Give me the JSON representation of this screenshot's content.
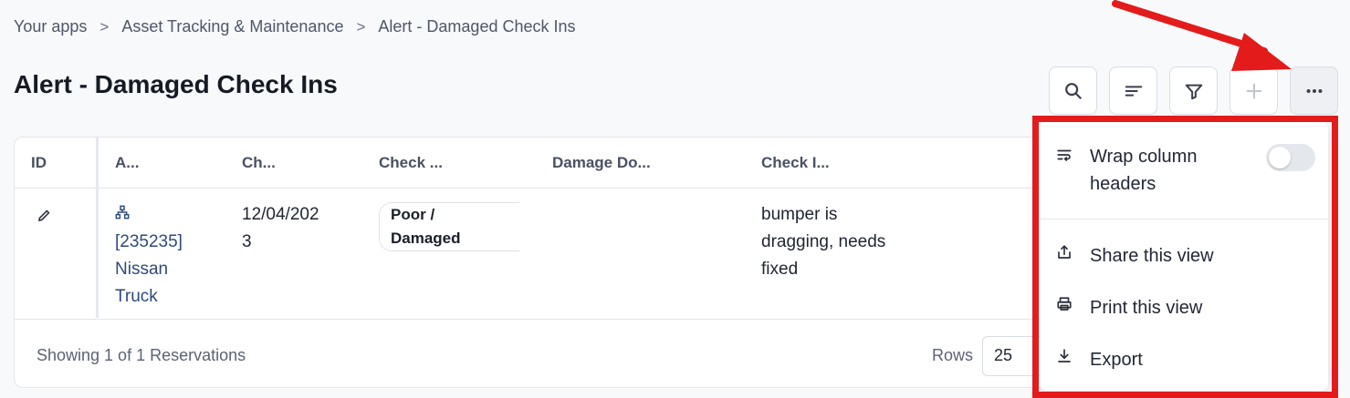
{
  "breadcrumb": {
    "items": [
      "Your apps",
      "Asset Tracking & Maintenance",
      "Alert - Damaged Check Ins"
    ],
    "separator": ">"
  },
  "page": {
    "title": "Alert - Damaged Check Ins"
  },
  "toolbar": {
    "buttons": [
      {
        "name": "search",
        "icon": "search-icon"
      },
      {
        "name": "sort",
        "icon": "sort-icon"
      },
      {
        "name": "filter",
        "icon": "filter-icon"
      },
      {
        "name": "add",
        "icon": "plus-icon",
        "disabled": true
      },
      {
        "name": "more",
        "icon": "ellipsis-icon",
        "active": true
      }
    ]
  },
  "table": {
    "columns": [
      "ID",
      "A...",
      "Ch...",
      "Check ...",
      "Damage Do...",
      "Check I..."
    ],
    "rows": [
      {
        "asset_line1": "[235235]",
        "asset_line2": "Nissan",
        "asset_line3": "Truck",
        "date_line1": "12/04/202",
        "date_line2": "3",
        "condition": "Poor / Damaged",
        "damage_doc": "",
        "notes_line1": "bumper is",
        "notes_line2": "dragging, needs",
        "notes_line3": "fixed"
      }
    ]
  },
  "footer": {
    "showing": "Showing 1 of 1 Reservations",
    "rows_label": "Rows",
    "rows_value": "25"
  },
  "menu": {
    "wrap_label_line1": "Wrap column",
    "wrap_label_line2": "headers",
    "wrap_enabled": false,
    "share": "Share this view",
    "print": "Print this view",
    "export": "Export"
  },
  "colors": {
    "annotation_red": "#e31b1b",
    "link_blue": "#2f4a7a",
    "background": "#f8f9fb"
  }
}
